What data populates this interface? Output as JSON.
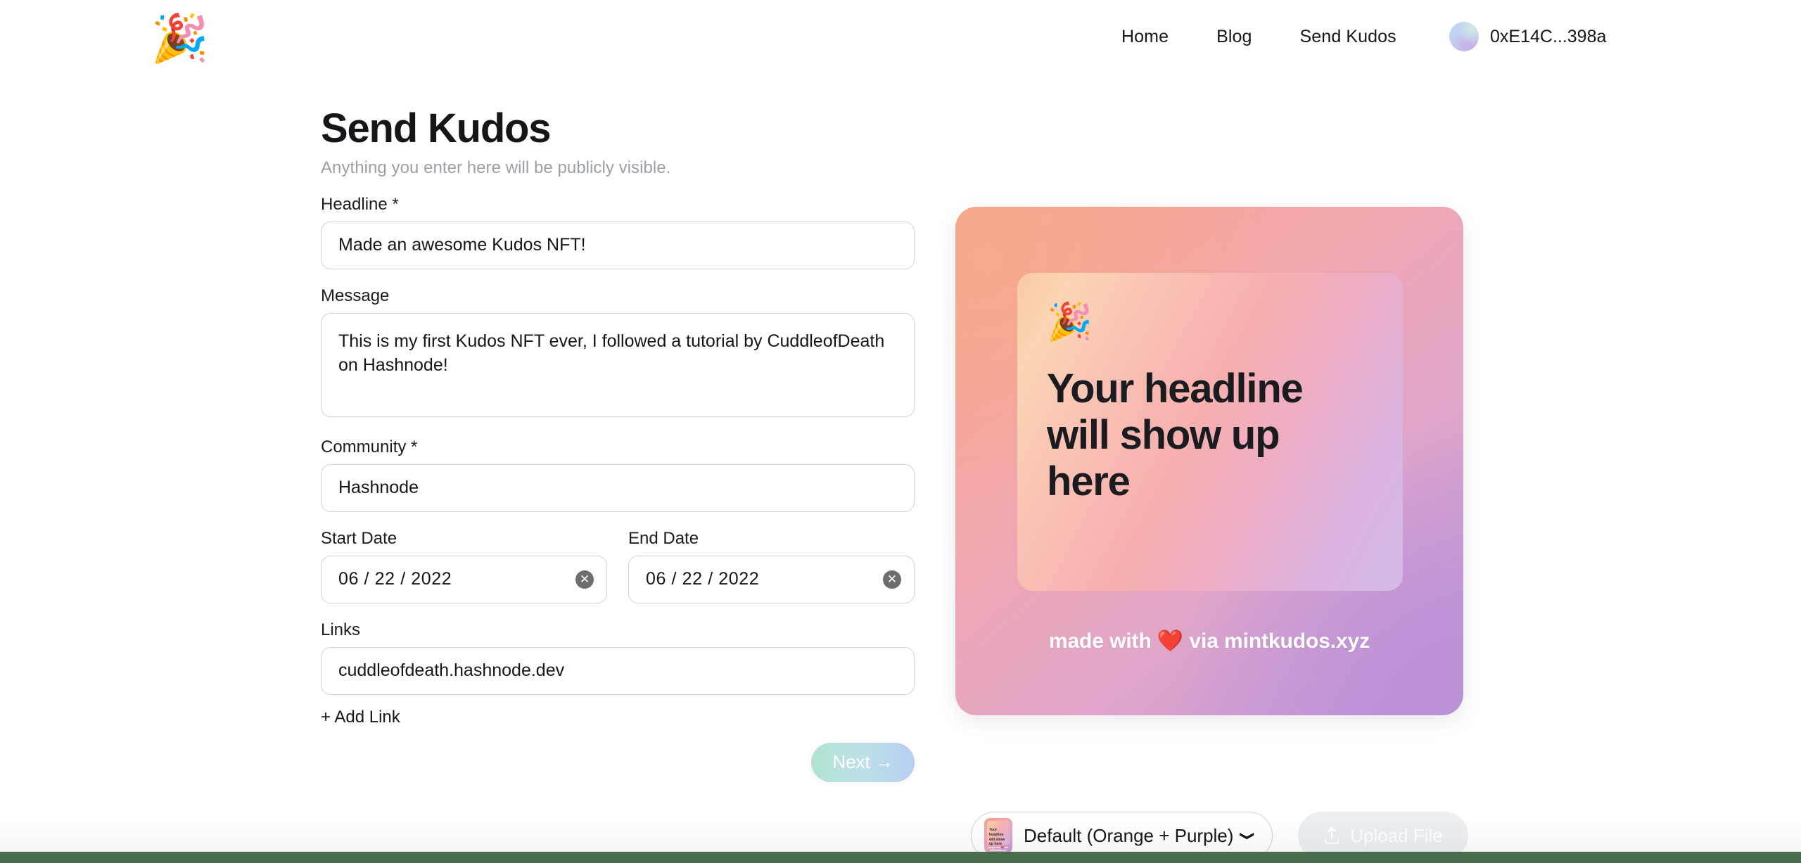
{
  "nav": {
    "logo_icon": "party-popper-emoji",
    "links": [
      {
        "label": "Home"
      },
      {
        "label": "Blog"
      },
      {
        "label": "Send Kudos"
      }
    ],
    "account": {
      "address": "0xE14C...398a",
      "avatar_icon": "gradient-avatar-circle"
    }
  },
  "form": {
    "title": "Send Kudos",
    "subtitle": "Anything you enter here will be publicly visible.",
    "headline": {
      "label": "Headline *",
      "value": "Made an awesome Kudos NFT!"
    },
    "message": {
      "label": "Message",
      "value": "This is my first Kudos NFT ever, I followed a tutorial by CuddleofDeath on Hashnode!"
    },
    "community": {
      "label": "Community *",
      "value": "Hashnode"
    },
    "start_date": {
      "label": "Start Date",
      "value": "06 / 22 / 2022",
      "clear_icon": "clear-circle-x-icon"
    },
    "end_date": {
      "label": "End Date",
      "value": "06 / 22 / 2022",
      "clear_icon": "clear-circle-x-icon"
    },
    "links": {
      "label": "Links",
      "value": "cuddleofdeath.hashnode.dev"
    },
    "add_link_label": "+ Add Link",
    "next_label": "Next →"
  },
  "preview": {
    "card_emoji": "party-popper-emoji",
    "headline_placeholder": "Your headline will show up here",
    "footer_text": "made with ❤️ via mintkudos.xyz",
    "theme": {
      "selected_label": "Default (Orange + Purple)",
      "thumb_headline": "Your headline will show up here",
      "thumb_footer": "made with ❤️ via mintkudos.xyz",
      "chevron_icon": "chevron-down-icon"
    },
    "upload": {
      "label": "Upload File",
      "icon": "upload-icon"
    }
  },
  "colors": {
    "card_start": "#f4a18b",
    "card_end": "#bb92d8",
    "footer_bar": "#4a6d4d",
    "next_gradient_start": "#b2e3d0",
    "next_gradient_end": "#b6cef0",
    "muted_text": "#9aa0a6",
    "border": "#cfd2d6"
  }
}
